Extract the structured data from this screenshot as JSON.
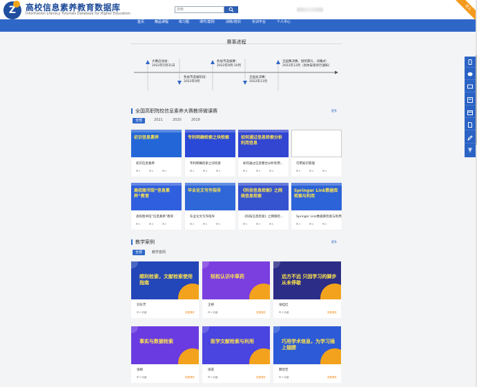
{
  "brand": {
    "title": "高校信息素养教育数据库",
    "subtitle": "Information Literacy Tutorials Database for Higher Education",
    "logo_letter": "Z"
  },
  "search": {
    "placeholder": "搜索"
  },
  "corner_badge": "进入",
  "nav": [
    "首页",
    "精品课程",
    "练习题",
    "课件/案例",
    "训练/培训",
    "实训平台",
    "个人中心"
  ],
  "progress": {
    "title": "赛事进程",
    "events": [
      {
        "name": "大赛启动会：",
        "date": "2022年5月31日"
      },
      {
        "name": "各省市选拔阶段：",
        "date": "2022年9月"
      },
      {
        "name": "各省市选拔赛：",
        "date": "2022年9月-10月"
      },
      {
        "name": "全国总决赛：",
        "date": "2022年11月"
      },
      {
        "name": "全国赛决赛、颁奖典礼、闭幕式：",
        "date": "2022年12月（具体安排另行通知）"
      }
    ]
  },
  "contest": {
    "title": "全国高职院校信息素养大赛教师微课赛",
    "more": "更多",
    "filters": [
      "全部",
      "2021",
      "2020",
      "2019"
    ],
    "cards": [
      {
        "thumb_text": "初识信息素养",
        "title": "初识信息素养",
        "bg": "#2366d8"
      },
      {
        "thumb_text": "专利明确检索之块检索",
        "title": "专利明确检索之块检索",
        "bg": "#2a49d6"
      },
      {
        "thumb_text": "如何通过信息检索分析利用信息",
        "title": "如何通过信息整合分析利用...",
        "bg": "#3246d2"
      },
      {
        "thumb_text": "",
        "title": "巧用知识管理",
        "bg": "#ffffff"
      },
      {
        "thumb_text": "高校图书馆“信息素养”教育",
        "title": "高校图书馆“信息素养”教育",
        "bg": "#2f5fde"
      },
      {
        "thumb_text": "毕业论文写作指导",
        "title": "毕业论文写作指导",
        "bg": "#2f67d9"
      },
      {
        "thumb_text": "《科技信息检索》之网络信息检索",
        "title": "《科技信息检索》之网络检...",
        "bg": "#3653cf"
      },
      {
        "thumb_text": "Springer Link数据库检索与利用",
        "title": "Springer Link数据库检索与利用",
        "bg": "#2d63d8"
      }
    ],
    "meta": [
      "0",
      "0"
    ]
  },
  "cases": {
    "title": "教学案例",
    "more": "更多",
    "filters": [
      "全部",
      "教学案例"
    ],
    "items": [
      {
        "thumb_text": "顺利检索，文献检索使用指南",
        "name": "刘东芳",
        "bg": "#2346b8",
        "accent": "#f2a21c"
      },
      {
        "thumb_text": "轻松认识中草药",
        "name": "王婷",
        "bg": "#7b3fe0",
        "accent": "#f2a21c"
      },
      {
        "thumb_text": "远方不远 只因学习的脚步从未停歇",
        "name": "张桂红",
        "bg": "#2b2d86",
        "accent": "#f2a21c"
      },
      {
        "thumb_text": "事实与数据检索",
        "name": "张娟",
        "bg": "#6a3be0",
        "accent": "#f2a21c"
      },
      {
        "thumb_text": "医学文献检索与利用",
        "name": "张莲",
        "bg": "#4a44e0",
        "accent": "#f2a21c"
      },
      {
        "thumb_text": "巧用学术信息，为学习插上翅膀",
        "name": "魏佳佳",
        "bg": "#2d5ad6",
        "accent": "#f2a21c"
      }
    ],
    "link": "查看课件",
    "meta": "0 收藏"
  }
}
